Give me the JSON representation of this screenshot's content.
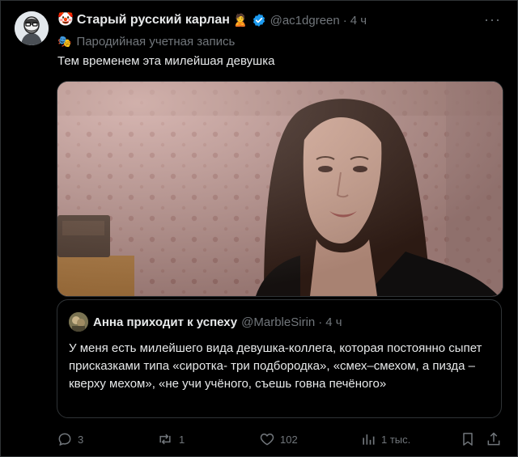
{
  "tweet": {
    "author_prefix_emoji": "🤡",
    "author_name": "Старый русский карлан",
    "author_suffix_emoji": "🙎",
    "handle": "@ac1dgreen",
    "separator": "·",
    "time": "4 ч",
    "more_label": "···",
    "parody_label": "Пародийная учетная запись",
    "parody_icon": "🎭",
    "text": "Тем временем эта милейшая девушка"
  },
  "quote": {
    "author_name": "Анна приходит к успеху",
    "handle": "@MarbleSirin",
    "separator": "·",
    "time": "4 ч",
    "text": "У меня есть милейшего вида девушка-коллега, которая постоянно сыпет присказками типа «сиротка- три подбородка», «смех–смехом, а пизда – кверху мехом», «не учи учёного, съешь говна печёного»"
  },
  "actions": {
    "replies": "3",
    "reposts": "1",
    "likes": "102",
    "views": "1 тыс."
  },
  "colors": {
    "background": "#000000",
    "text": "#e7e9ea",
    "muted": "#71767b",
    "border": "#2f3336",
    "verified": "#1d9bf0"
  },
  "icons": {
    "verified": "verified-badge-icon",
    "more": "more-dots-icon",
    "reply": "reply-icon",
    "repost": "repost-icon",
    "like": "heart-icon",
    "views": "views-chart-icon",
    "bookmark": "bookmark-icon",
    "share": "share-icon"
  }
}
